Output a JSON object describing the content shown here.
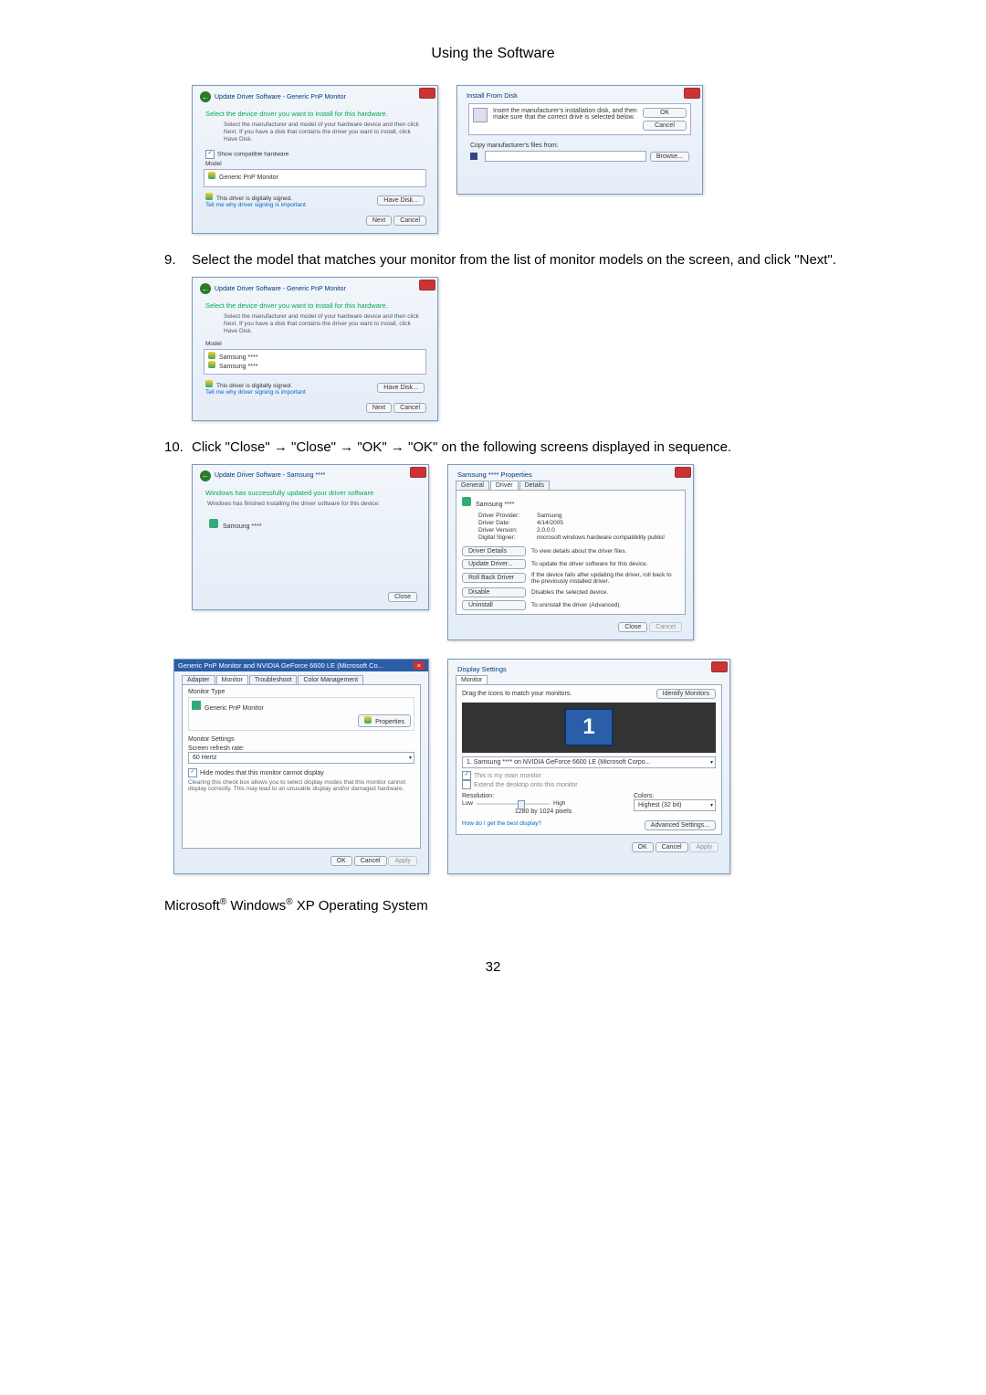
{
  "page_title": "Using the Software",
  "page_number": "32",
  "steps": {
    "9": {
      "num": "9.",
      "text": "Select the model that matches your monitor from the list of monitor models on the screen, and click \"Next\"."
    },
    "10": {
      "num": "10.",
      "text": "Click \"Close\" → \"Close\" → \"OK\" → \"OK\" on the following screens displayed in sequence."
    }
  },
  "footer": {
    "prefix": "Microsoft",
    "reg1": "®",
    "mid": " Windows",
    "reg2": "®",
    "suffix": " XP Operating System"
  },
  "dlg_update1": {
    "breadcrumb": "Update Driver Software - Generic PnP Monitor",
    "header": "Select the device driver you want to install for this hardware.",
    "sub": "Select the manufacturer and model of your hardware device and then click Next. If you have a disk that contains the driver you want to install, click Have Disk.",
    "compat_chk": "Show compatible hardware",
    "model_label": "Model",
    "model_item": "Generic PnP Monitor",
    "signed": "This driver is digitally signed.",
    "signed_link": "Tell me why driver signing is important",
    "have_disk": "Have Disk...",
    "next": "Next",
    "cancel": "Cancel"
  },
  "dlg_install_disk": {
    "title": "Install From Disk",
    "text": "Insert the manufacturer's installation disk, and then make sure that the correct drive is selected below.",
    "ok": "OK",
    "cancel": "Cancel",
    "copy_label": "Copy manufacturer's files from:",
    "browse": "Browse..."
  },
  "dlg_update2": {
    "breadcrumb": "Update Driver Software - Generic PnP Monitor",
    "header": "Select the device driver you want to install for this hardware.",
    "sub": "Select the manufacturer and model of your hardware device and then click Next. If you have a disk that contains the driver you want to install, click Have Disk.",
    "model_label": "Model",
    "item1": "Samsung ****",
    "item2": "Samsung ****",
    "signed": "This driver is digitally signed.",
    "signed_link": "Tell me why driver signing is important",
    "have_disk": "Have Disk...",
    "next": "Next",
    "cancel": "Cancel"
  },
  "dlg_success": {
    "breadcrumb": "Update Driver Software - Samsung ****",
    "header": "Windows has successfully updated your driver software",
    "sub": "Windows has finished installing the driver software for this device:",
    "device": "Samsung ****",
    "close": "Close"
  },
  "dlg_props": {
    "title": "Samsung **** Properties",
    "tabs": [
      "General",
      "Driver",
      "Details"
    ],
    "device": "Samsung ****",
    "rows": {
      "provider_l": "Driver Provider:",
      "provider_v": "Samsung",
      "date_l": "Driver Date:",
      "date_v": "4/14/2005",
      "ver_l": "Driver Version:",
      "ver_v": "2.0.0.0",
      "signer_l": "Digital Signer:",
      "signer_v": "microsoft windows hardware compatibility publisl"
    },
    "btns": {
      "details": "Driver Details",
      "details_d": "To view details about the driver files.",
      "update": "Update Driver...",
      "update_d": "To update the driver software for this device.",
      "rollback": "Roll Back Driver",
      "rollback_d": "If the device fails after updating the driver, roll back to the previously installed driver.",
      "disable": "Disable",
      "disable_d": "Disables the selected device.",
      "uninstall": "Uninstall",
      "uninstall_d": "To uninstall the driver (Advanced)."
    },
    "close": "Close",
    "cancel": "Cancel"
  },
  "dlg_generic": {
    "title": "Generic PnP Monitor and NVIDIA GeForce 6600 LE (Microsoft Co...",
    "tabs": [
      "Adapter",
      "Monitor",
      "Troubleshoot",
      "Color Management"
    ],
    "type_label": "Monitor Type",
    "type_value": "Generic PnP Monitor",
    "properties": "Properties",
    "settings_label": "Monitor Settings",
    "refresh_label": "Screen refresh rate:",
    "refresh_value": "60 Hertz",
    "hide_chk": "Hide modes that this monitor cannot display",
    "hide_desc": "Clearing this check box allows you to select display modes that this monitor cannot display correctly. This may lead to an unusable display and/or damaged hardware.",
    "ok": "OK",
    "cancel": "Cancel",
    "apply": "Apply"
  },
  "dlg_display": {
    "title": "Display Settings",
    "tabs": [
      "Monitor"
    ],
    "drag": "Drag the icons to match your monitors.",
    "identify": "Identify Monitors",
    "combo": "1. Samsung **** on NVIDIA GeForce 6600 LE (Microsoft Corpo...",
    "main_chk": "This is my main monitor",
    "extend_chk": "Extend the desktop onto this monitor",
    "res_label": "Resolution:",
    "res_low": "Low",
    "res_high": "High",
    "res_value": "1280 by 1024 pixels",
    "colors_label": "Colors:",
    "colors_value": "Highest (32 bit)",
    "best_link": "How do I get the best display?",
    "advanced": "Advanced Settings...",
    "ok": "OK",
    "cancel": "Cancel",
    "apply": "Apply"
  }
}
